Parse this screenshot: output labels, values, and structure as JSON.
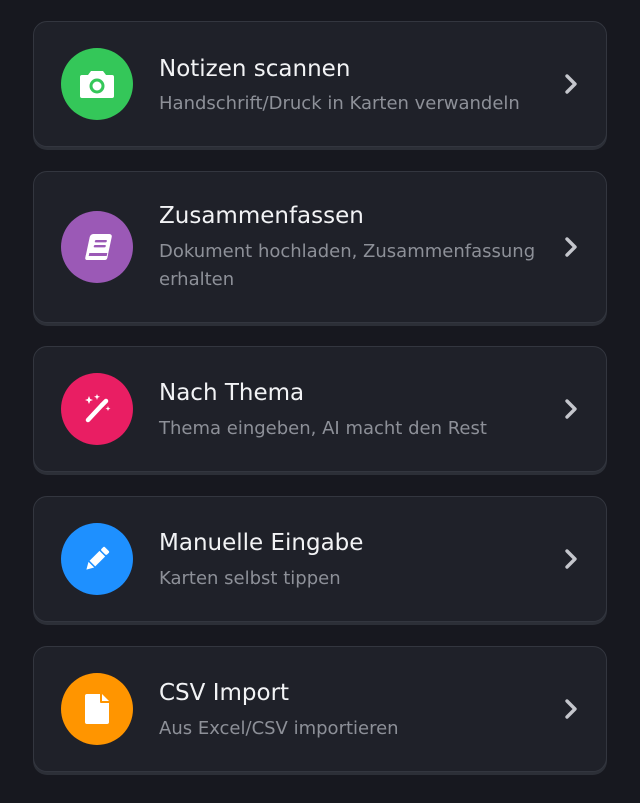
{
  "options": [
    {
      "title": "Notizen scannen",
      "subtitle": "Handschrift/Druck in Karten verwandeln",
      "icon": "camera-icon",
      "color": "#34c759"
    },
    {
      "title": "Zusammenfassen",
      "subtitle": "Dokument hochladen, Zusammenfassung erhalten",
      "icon": "book-icon",
      "color": "#9b59b6"
    },
    {
      "title": "Nach Thema",
      "subtitle": "Thema eingeben, AI macht den Rest",
      "icon": "magic-wand-icon",
      "color": "#e91e63"
    },
    {
      "title": "Manuelle Eingabe",
      "subtitle": "Karten selbst tippen",
      "icon": "pencil-icon",
      "color": "#1e90ff"
    },
    {
      "title": "CSV Import",
      "subtitle": "Aus Excel/CSV importieren",
      "icon": "file-icon",
      "color": "#ff9500"
    }
  ]
}
